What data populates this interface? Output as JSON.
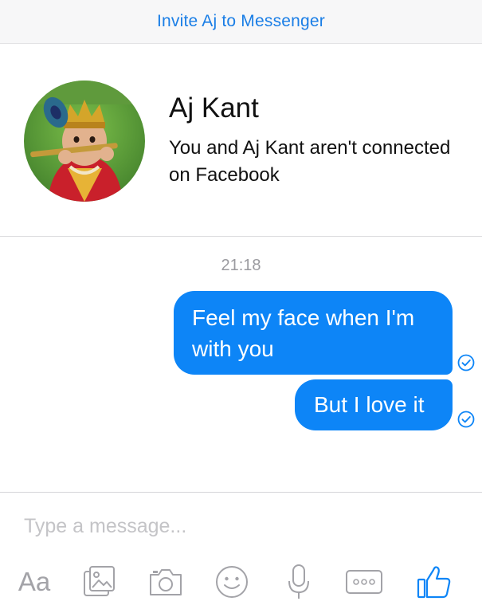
{
  "header": {
    "invite_label": "Invite Aj to Messenger"
  },
  "profile": {
    "name": "Aj Kant",
    "status": "You and Aj Kant aren't connected on Facebook"
  },
  "conversation": {
    "timestamp": "21:18",
    "messages": [
      {
        "text": "Feel my face when I'm with you",
        "sender": "me",
        "status": "seen-check-icon"
      },
      {
        "text": "But I love it",
        "sender": "me",
        "status": "seen-check-icon"
      }
    ]
  },
  "composer": {
    "placeholder": "Type a message...",
    "value": "",
    "text_format_label": "Aa",
    "icons": [
      "text-format-icon",
      "photo-gallery-icon",
      "camera-icon",
      "emoji-icon",
      "microphone-icon",
      "more-icon",
      "thumbs-up-icon"
    ]
  },
  "colors": {
    "accent": "#0d85f7",
    "link": "#1a7ee6",
    "icon_gray": "#a3a3a8"
  }
}
